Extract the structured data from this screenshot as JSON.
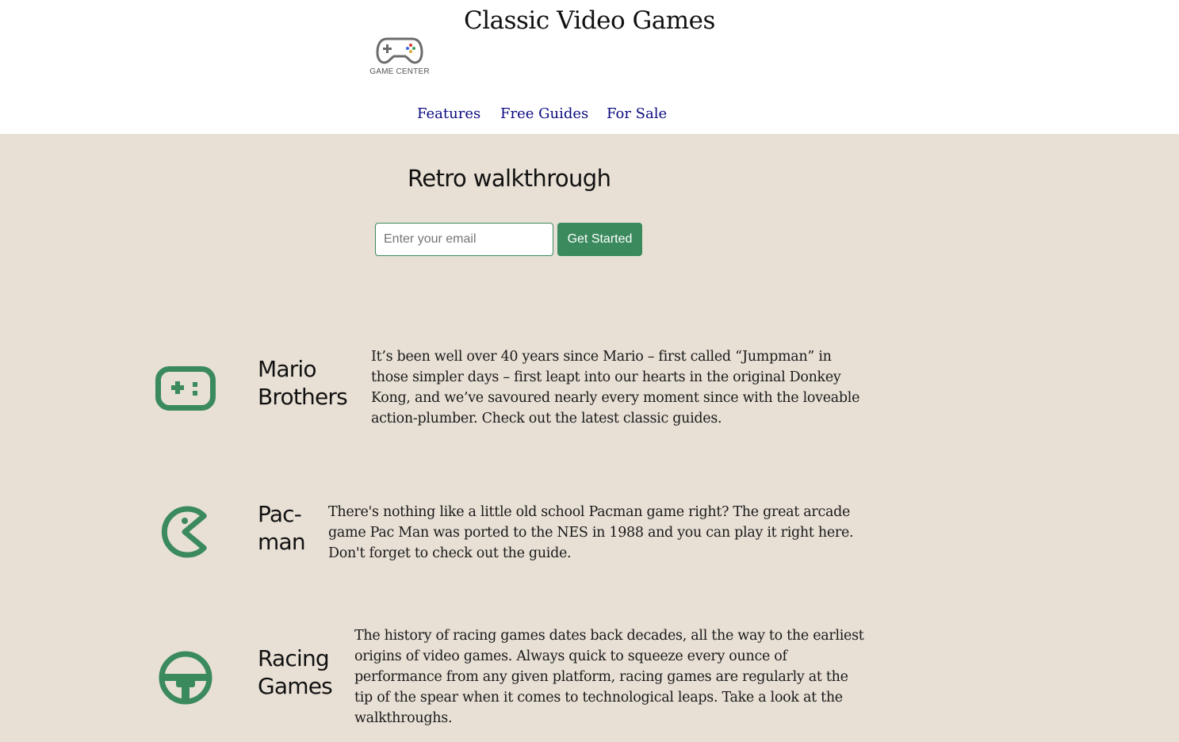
{
  "header": {
    "site_title": "Classic Video Games",
    "logo_text": "GAME CENTER",
    "logo_icon": "gamepad-logo-icon"
  },
  "nav": {
    "items": [
      {
        "label": "Features"
      },
      {
        "label": "Free Guides"
      },
      {
        "label": "For Sale"
      }
    ]
  },
  "hero": {
    "title": "Retro walkthrough",
    "email_placeholder": "Enter your email",
    "cta_label": "Get Started"
  },
  "features": [
    {
      "icon": "gamepad-icon",
      "title_line1": "Mario",
      "title_line2": "Brothers",
      "text": "It’s been well over 40 years since Mario – first called “Jumpman” in those simpler days – first leapt into our hearts in the original Donkey Kong, and we’ve savoured nearly every moment since with the loveable action-plumber. Check out the latest classic guides."
    },
    {
      "icon": "pacman-icon",
      "title_line1": "Pac-",
      "title_line2": "man",
      "text": "There's nothing like a little old school Pacman game right? The great arcade game Pac Man was ported to the NES in 1988 and you can play it right here. Don't forget to check out the guide."
    },
    {
      "icon": "steering-wheel-icon",
      "title_line1": "Racing",
      "title_line2": "Games",
      "text": "The history of racing games dates back decades, all the way to the earliest origins of video games. Always quick to squeeze every ounce of performance from any given platform, racing games are regularly at the tip of the spear when it comes to technological leaps. Take a look at the walkthroughs."
    }
  ],
  "colors": {
    "background": "#e8e0d5",
    "header_bg": "#ffffff",
    "accent_green": "#3a8a5e",
    "nav_link": "#0a0a80"
  }
}
